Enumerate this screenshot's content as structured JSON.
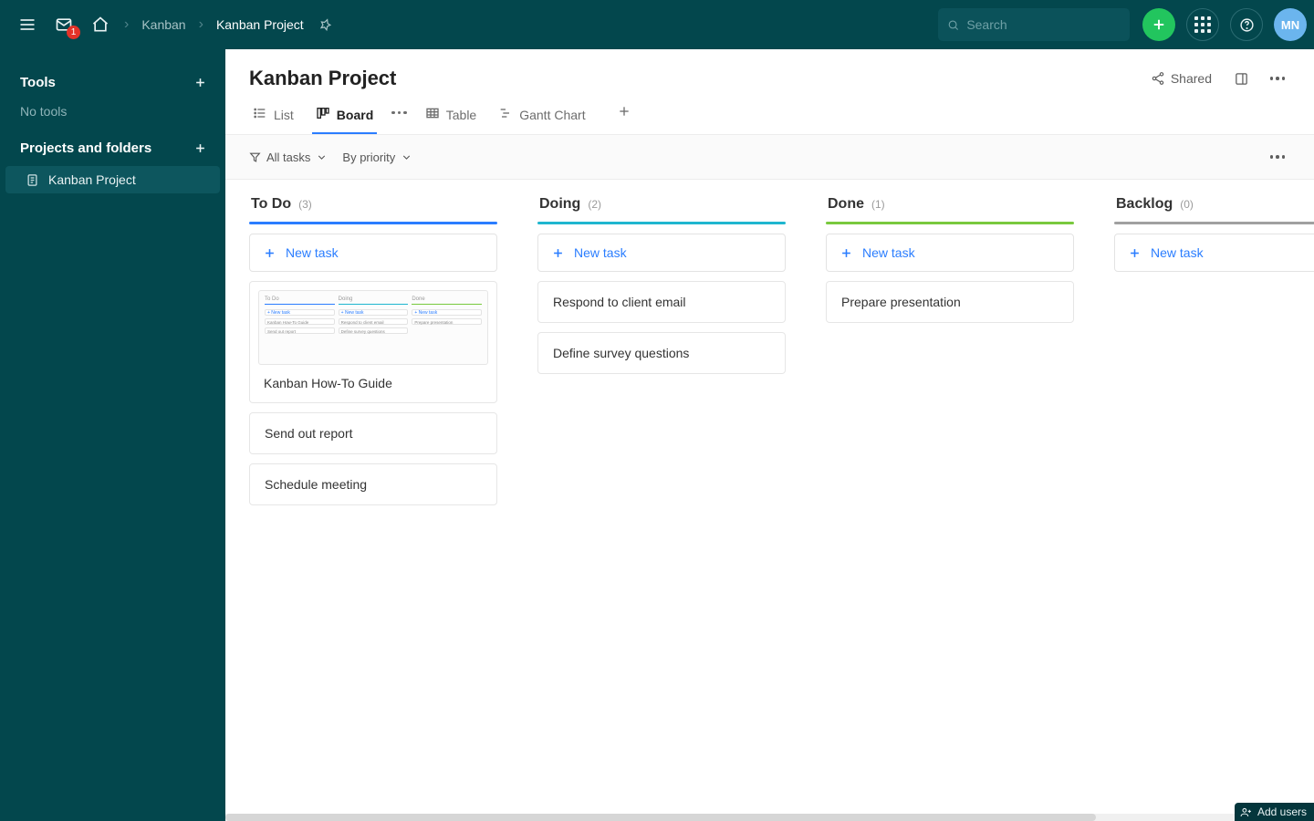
{
  "header": {
    "inbox_badge": "1",
    "breadcrumbs": [
      "Kanban",
      "Kanban Project"
    ],
    "search_placeholder": "Search",
    "avatar_initials": "MN"
  },
  "sidebar": {
    "tools_label": "Tools",
    "tools_empty": "No tools",
    "projects_label": "Projects and folders",
    "items": [
      {
        "label": "Kanban Project",
        "active": true
      }
    ]
  },
  "page": {
    "title": "Kanban Project",
    "shared_label": "Shared"
  },
  "tabs": [
    {
      "label": "List",
      "active": false
    },
    {
      "label": "Board",
      "active": true
    },
    {
      "label": "Table",
      "active": false
    },
    {
      "label": "Gantt Chart",
      "active": false
    }
  ],
  "filters": {
    "tasks_label": "All tasks",
    "sort_label": "By priority"
  },
  "board": {
    "new_task_label": "New task",
    "columns": [
      {
        "title": "To Do",
        "count": "(3)",
        "color": "#2a7dff",
        "cards": [
          {
            "title": "Kanban How-To Guide",
            "has_preview": true
          },
          {
            "title": "Send out report"
          },
          {
            "title": "Schedule meeting"
          }
        ]
      },
      {
        "title": "Doing",
        "count": "(2)",
        "color": "#1fb6cf",
        "cards": [
          {
            "title": "Respond to client email"
          },
          {
            "title": "Define survey questions"
          }
        ]
      },
      {
        "title": "Done",
        "count": "(1)",
        "color": "#79c93e",
        "cards": [
          {
            "title": "Prepare presentation"
          }
        ]
      },
      {
        "title": "Backlog",
        "count": "(0)",
        "color": "#a0a0a0",
        "cards": []
      }
    ]
  },
  "footer": {
    "add_users_label": "Add users"
  },
  "preview_mini": {
    "cols": [
      {
        "hdr": "To Do",
        "hdr_color": "#2a7dff",
        "rows": [
          "",
          "Kanban How-To Guide",
          "Send out report"
        ]
      },
      {
        "hdr": "Doing",
        "hdr_color": "#1fb6cf",
        "rows": [
          "",
          "Respond to client email",
          "Define survey questions"
        ]
      },
      {
        "hdr": "Done",
        "hdr_color": "#79c93e",
        "rows": [
          "",
          "Prepare presentation"
        ]
      }
    ]
  }
}
